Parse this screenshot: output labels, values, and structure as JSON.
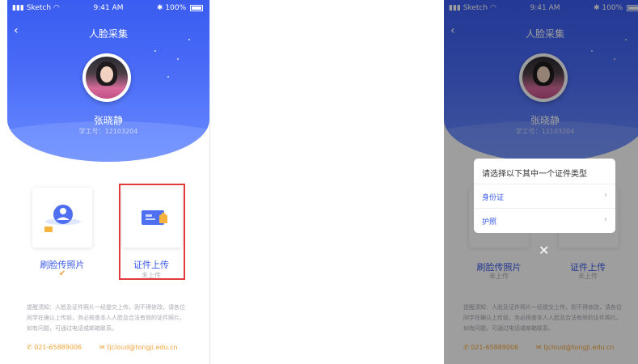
{
  "status_bar": {
    "carrier": "Sketch",
    "time": "9:41 AM",
    "battery": "100%"
  },
  "nav": {
    "back_icon": "‹",
    "title": "人脸采集"
  },
  "profile": {
    "name": "张晓静",
    "student_id": "学工号：12103204"
  },
  "cards": {
    "face": {
      "label": "刷脸传照片",
      "status_icon": "✔"
    },
    "id": {
      "label": "证件上传",
      "status": "未上传"
    }
  },
  "notice": "提醒须知：人脸及证件照片一经提交上传，则不得修改，请各位同学在确认上传前，务必核查本人人脸及合法有效的证件照片。如有问题，可通过电话或邮箱联系。",
  "contacts": {
    "phone": "021-65889006",
    "email": "tjcloud@tongji.edu.cn"
  },
  "dialog": {
    "title": "请选择以下其中一个证件类型",
    "options": [
      "身份证",
      "护照"
    ],
    "chevron": "›",
    "close_icon": "✕"
  },
  "right_cards": {
    "face_label": "刷脸传照片",
    "id_label": "证件上传",
    "status": "未上传"
  },
  "colors": {
    "primary": "#3b5ae8",
    "highlight": "#e23b3b",
    "accent": "#f0a43a"
  }
}
